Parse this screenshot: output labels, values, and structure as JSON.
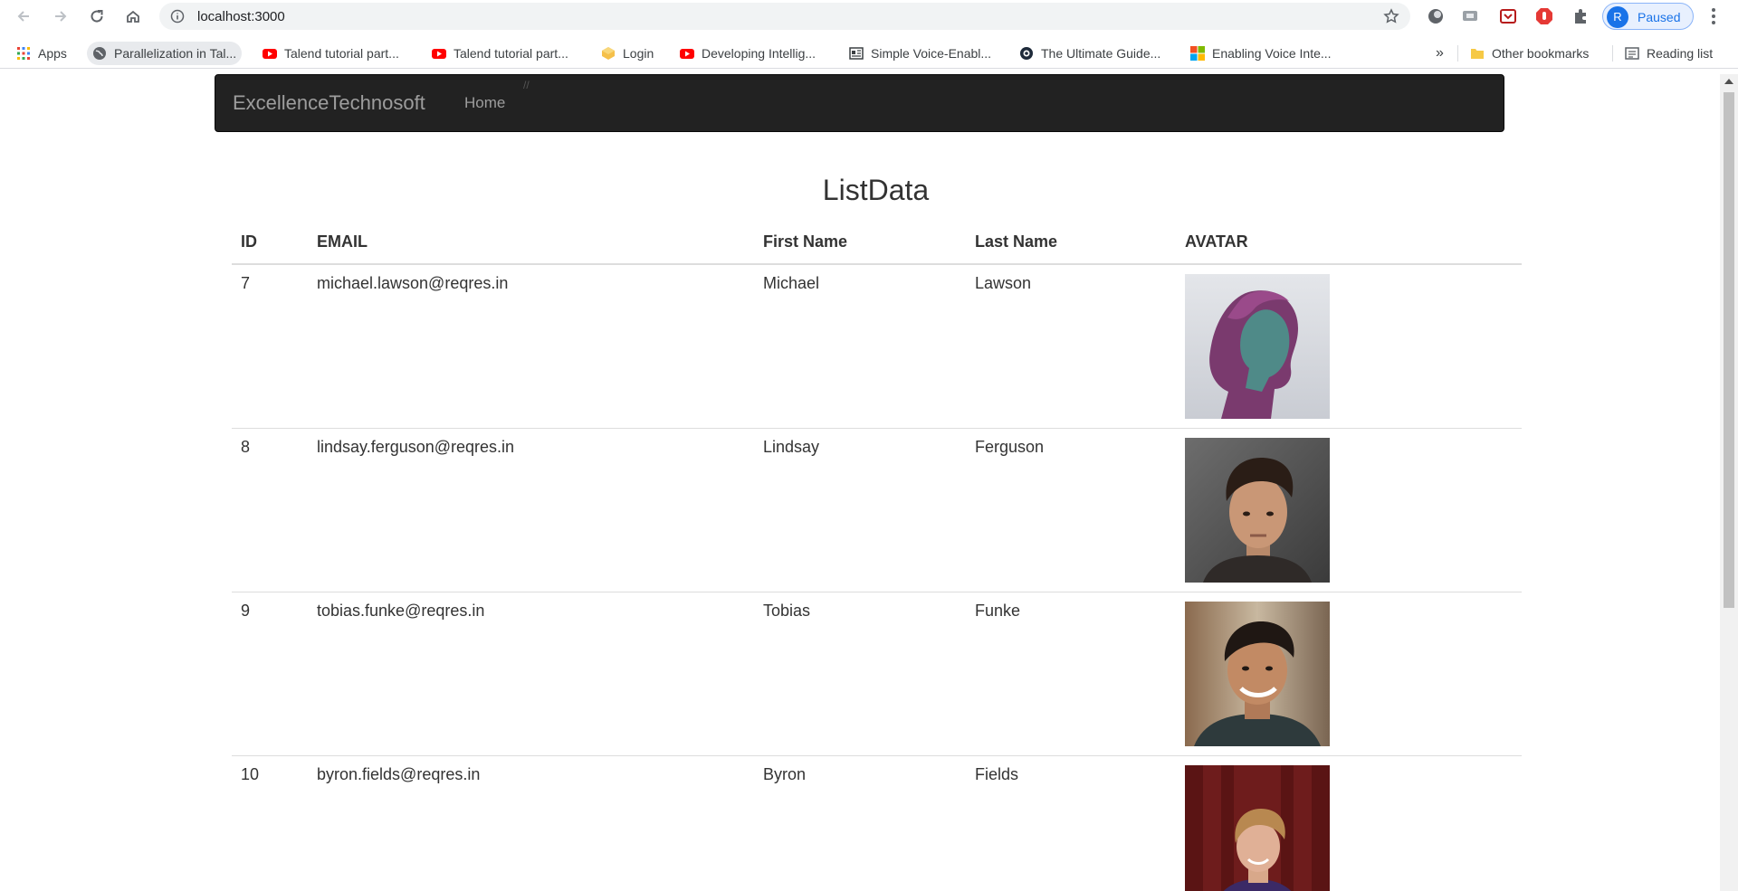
{
  "browser": {
    "url": "localhost:3000",
    "profile_initial": "R",
    "profile_status": "Paused"
  },
  "bookmarks": {
    "items": [
      {
        "label": "Apps",
        "icon": "apps-grid-icon"
      },
      {
        "label": "Parallelization in Tal...",
        "icon": "globe-icon"
      },
      {
        "label": "Talend tutorial part...",
        "icon": "youtube-icon"
      },
      {
        "label": "Talend tutorial part...",
        "icon": "youtube-icon"
      },
      {
        "label": "Login",
        "icon": "login-icon"
      },
      {
        "label": "Developing Intellig...",
        "icon": "youtube-icon"
      },
      {
        "label": "Simple Voice-Enabl...",
        "icon": "article-icon"
      },
      {
        "label": "The Ultimate Guide...",
        "icon": "site-icon"
      },
      {
        "label": "Enabling Voice Inte...",
        "icon": "microsoft-icon"
      }
    ],
    "overflow": "»",
    "other": "Other bookmarks",
    "reading_list": "Reading list"
  },
  "navbar": {
    "brand": "ExcellenceTechnosoft",
    "home": "Home",
    "slash": "//"
  },
  "page": {
    "title": "ListData"
  },
  "table": {
    "headers": [
      "ID",
      "EMAIL",
      "First Name",
      "Last Name",
      "AVATAR"
    ],
    "rows": [
      {
        "id": "7",
        "email": "michael.lawson@reqres.in",
        "first": "Michael",
        "last": "Lawson",
        "avatar": "avatar-photo-purple-hair-profile"
      },
      {
        "id": "8",
        "email": "lindsay.ferguson@reqres.in",
        "first": "Lindsay",
        "last": "Ferguson",
        "avatar": "avatar-photo-young-man-grey"
      },
      {
        "id": "9",
        "email": "tobias.funke@reqres.in",
        "first": "Tobias",
        "last": "Funke",
        "avatar": "avatar-photo-smiling-man"
      },
      {
        "id": "10",
        "email": "byron.fields@reqres.in",
        "first": "Byron",
        "last": "Fields",
        "avatar": "avatar-photo-man-red-background"
      }
    ]
  },
  "colors": {
    "navbar_bg": "#222222",
    "navbar_text": "#9d9d9d",
    "omnibox_bg": "#f1f3f4",
    "profile_accent": "#1a73e8"
  }
}
